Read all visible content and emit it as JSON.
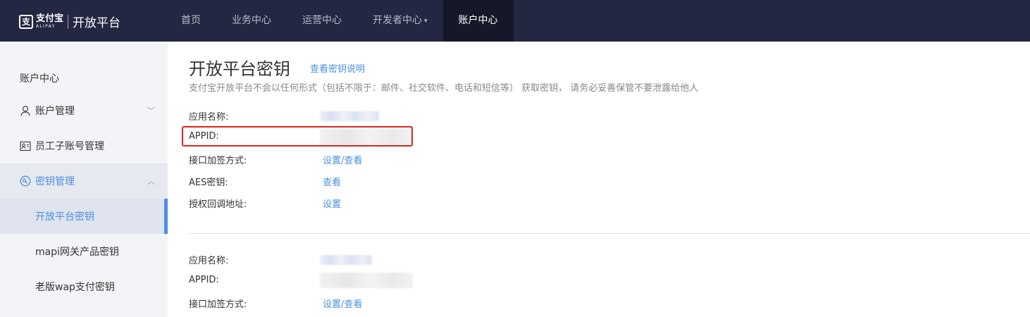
{
  "brand": {
    "mark": "支",
    "cn": "支付宝",
    "en": "ALIPAY",
    "platform": "开放平台"
  },
  "nav": [
    {
      "label": "首页"
    },
    {
      "label": "业务中心"
    },
    {
      "label": "运营中心"
    },
    {
      "label": "开发者中心",
      "caret": "▾"
    },
    {
      "label": "账户中心",
      "active": true
    }
  ],
  "sidebar": {
    "title": "账户中心",
    "groups": [
      {
        "label": "账户管理",
        "icon": "user-icon",
        "chevron": "﹀"
      },
      {
        "label": "员工子账号管理",
        "icon": "id-card-icon"
      },
      {
        "label": "密钥管理",
        "icon": "key-icon",
        "chevron": "︿"
      }
    ],
    "subitems": [
      {
        "label": "开放平台密钥",
        "active": true
      },
      {
        "label": "mapi网关产品密钥"
      },
      {
        "label": "老版wap支付密钥"
      }
    ]
  },
  "main": {
    "title": "开放平台密钥",
    "help_link": "查看密钥说明",
    "notice": "支付宝开放平台不会以任何形式（包括不限于：邮件、社交软件、电话和短信等） 获取密钥， 请务必妥善保管不要泄露给他人",
    "app1": {
      "name_label": "应用名称:",
      "appid_label": "APPID:",
      "sign_label": "接口加签方式:",
      "sign_link": "设置/查看",
      "aes_label": "AES密钥:",
      "aes_link": "查看",
      "callback_label": "授权回调地址:",
      "callback_link": "设置"
    },
    "app2": {
      "name_label": "应用名称:",
      "appid_label": "APPID:",
      "sign_label": "接口加签方式:",
      "sign_link": "设置/查看"
    }
  },
  "colors": {
    "accent": "#4a90e2",
    "topbar": "#232741",
    "highlight": "#e2231a"
  }
}
